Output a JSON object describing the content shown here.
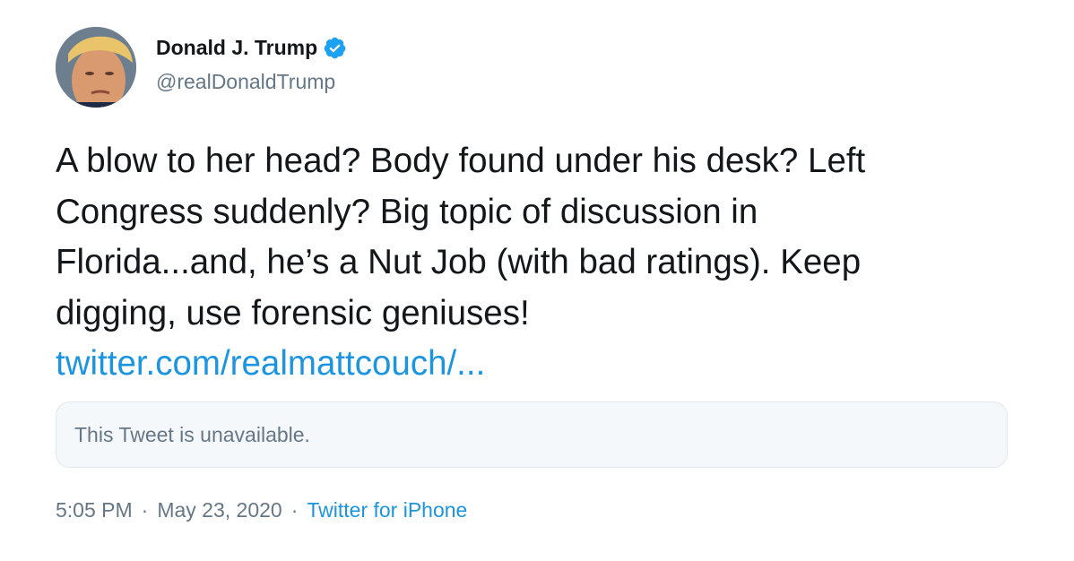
{
  "author": {
    "name": "Donald J. Trump",
    "handle": "@realDonaldTrump",
    "verified": true,
    "avatar": "profile-photo"
  },
  "tweet": {
    "lines": [
      "A blow to her head? Body found under his desk? Left",
      "Congress suddenly? Big topic of discussion in",
      "Florida...and, he’s a Nut Job (with bad ratings). Keep",
      "digging, use forensic geniuses!"
    ],
    "link": "twitter.com/realmattcouch/..."
  },
  "quote": {
    "text": "This Tweet is unavailable."
  },
  "meta": {
    "time": "5:05 PM",
    "separator": "·",
    "date": "May 23, 2020",
    "source": "Twitter for iPhone"
  },
  "colors": {
    "link": "#1b95e0",
    "secondary_text": "#657786",
    "verified_badge": "#1da1f2",
    "quote_background": "#f5f8fa",
    "quote_border": "#e1e8ed"
  }
}
